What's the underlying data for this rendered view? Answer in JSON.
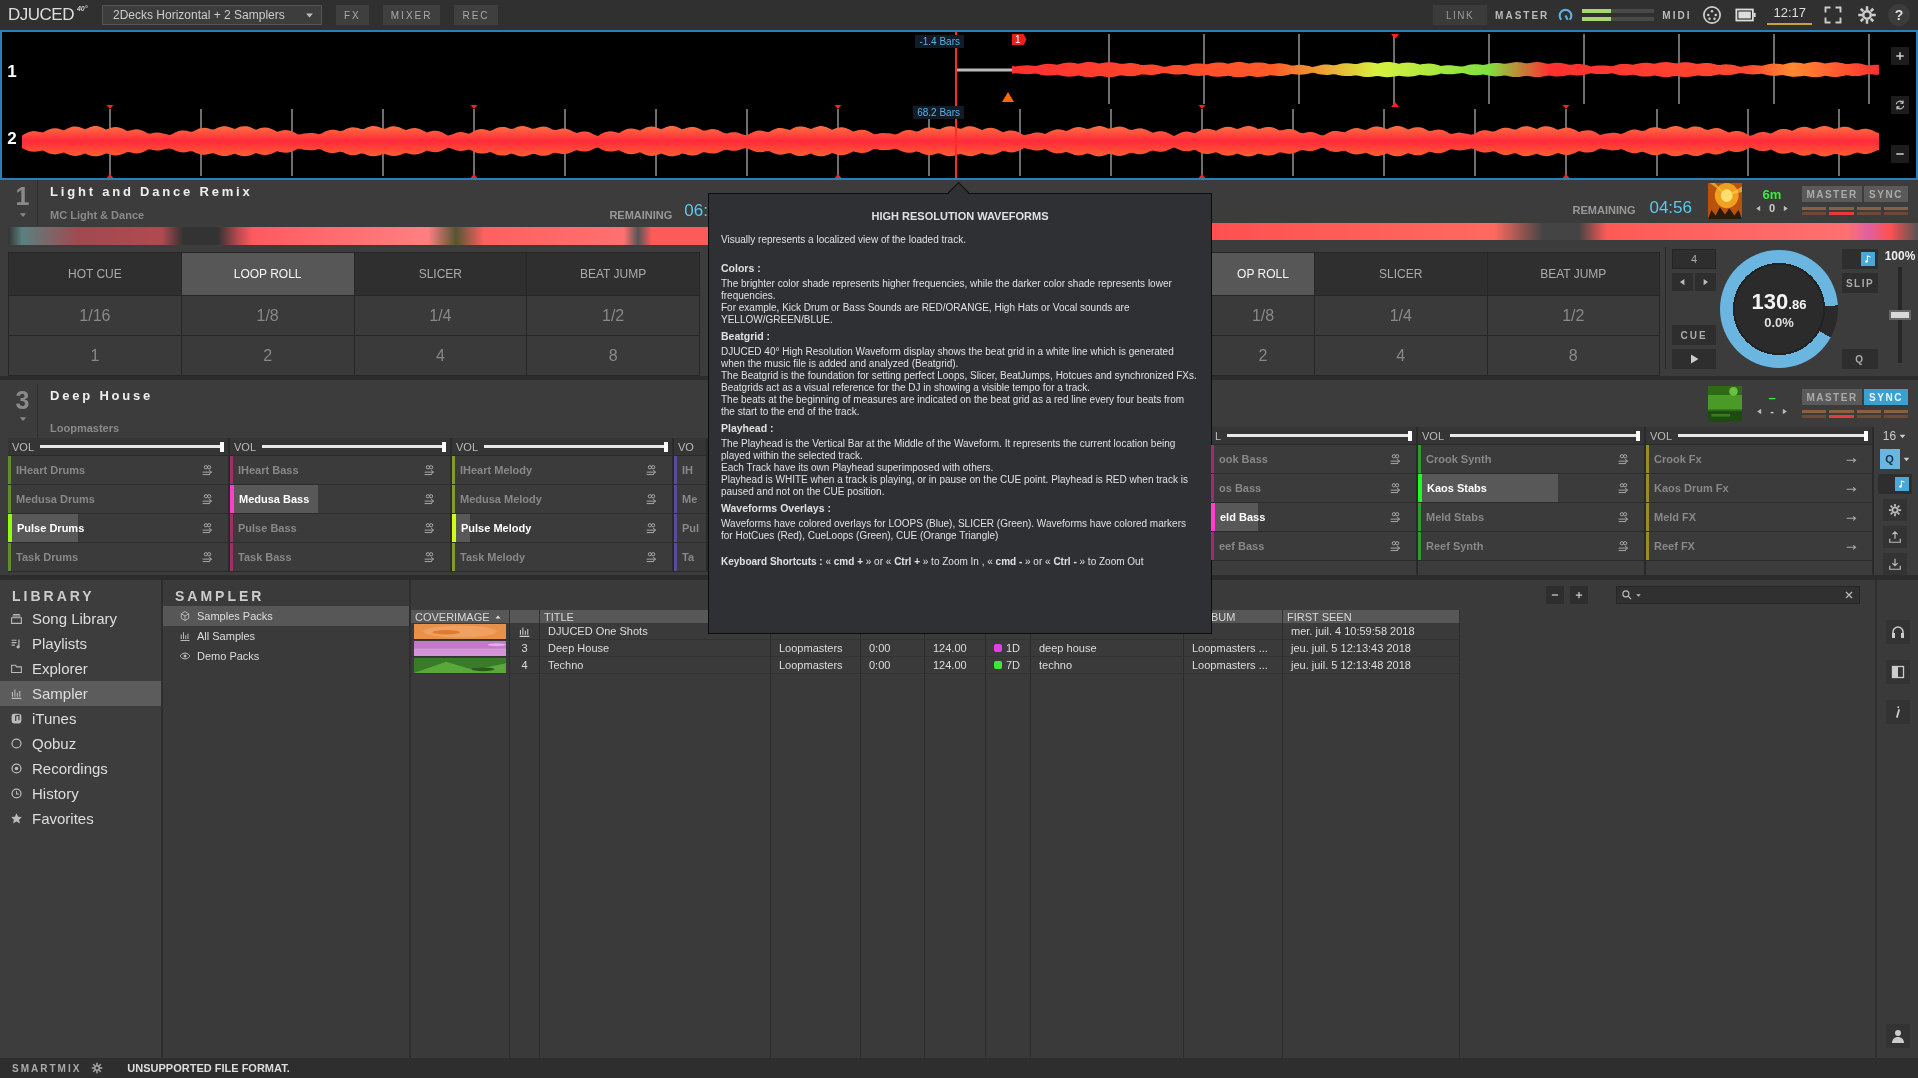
{
  "top_bar": {
    "logo": "DJUCED",
    "logo_mark": "40°",
    "layout": "2Decks Horizontal + 2 Samplers",
    "buttons": [
      {
        "label": "FX"
      },
      {
        "label": "MIXER"
      },
      {
        "label": "REC"
      }
    ],
    "link": "LINK",
    "master": "MASTER",
    "midi": "MIDI",
    "clock": "12:17",
    "help": "?"
  },
  "waveforms": {
    "lanes": [
      {
        "number": "1",
        "position": "-1.4 Bars",
        "cue_label": "1"
      },
      {
        "number": "2",
        "position": "68.2 Bars"
      }
    ]
  },
  "deck_1": {
    "number": "1",
    "title": "Light and Dance Remix",
    "artist": "MC Light & Dance",
    "remaining_label": "REMAINING",
    "remaining": "06:",
    "pad_modes": [
      {
        "label": "HOT CUE",
        "selected": false
      },
      {
        "label": "LOOP ROLL",
        "selected": true
      },
      {
        "label": "SLICER",
        "selected": false
      },
      {
        "label": "BEAT JUMP",
        "selected": false
      }
    ],
    "pads": [
      "1/16",
      "1/8",
      "1/4",
      "1/2",
      "1",
      "2",
      "4",
      "8"
    ]
  },
  "deck_2": {
    "remaining_label": "REMAINING",
    "remaining": "04:56",
    "key": "6m",
    "transpose": "0",
    "master": {
      "label": "MASTER",
      "on": false
    },
    "sync": {
      "label": "SYNC",
      "on": false
    },
    "pad_modes": [
      {
        "label": "OP ROLL",
        "selected": true
      },
      {
        "label": "SLICER",
        "selected": false
      },
      {
        "label": "BEAT JUMP",
        "selected": false
      }
    ],
    "pads": [
      "1/8",
      "1/4",
      "1/2",
      "2",
      "4",
      "8"
    ],
    "beats": "4",
    "cue": "CUE",
    "bpm": "130",
    "bpm_decimals": ".86",
    "pitch": "0.0%",
    "pitch_range": "100%",
    "slip": "SLIP",
    "quantize": "Q",
    "pitch_fader": {
      "level": 0.5
    }
  },
  "sampler_3": {
    "number": "3",
    "title": "Deep House",
    "artist": "Loopmasters",
    "columns": [
      {
        "vol": "VOL",
        "level": 1,
        "color": "#5f8f2a",
        "slots": [
          {
            "name": "IHeart Drums",
            "kind": "loop",
            "playing": false
          },
          {
            "name": "Medusa Drums",
            "kind": "loop",
            "playing": false
          },
          {
            "name": "Pulse Drums",
            "kind": "loop",
            "playing": true,
            "level": 0.32
          },
          {
            "name": "Task Drums",
            "kind": "loop",
            "playing": false
          }
        ]
      },
      {
        "vol": "VOL",
        "level": 1,
        "color": "#9b2f6a",
        "slots": [
          {
            "name": "IHeart Bass",
            "kind": "loop",
            "playing": false
          },
          {
            "name": "Medusa Bass",
            "kind": "loop",
            "playing": true,
            "level": 0.4
          },
          {
            "name": "Pulse Bass",
            "kind": "loop",
            "playing": false
          },
          {
            "name": "Task Bass",
            "kind": "loop",
            "playing": false
          }
        ]
      },
      {
        "vol": "VOL",
        "level": 1,
        "color": "#7f9a2f",
        "slots": [
          {
            "name": "IHeart Melody",
            "kind": "loop",
            "playing": false
          },
          {
            "name": "Medusa Melody",
            "kind": "loop",
            "playing": false
          },
          {
            "name": "Pulse Melody",
            "kind": "loop",
            "playing": true,
            "level": 0.08
          },
          {
            "name": "Task Melody",
            "kind": "loop",
            "playing": false
          }
        ]
      },
      {
        "vol": "VO",
        "color": "#5a4a9a",
        "slots": [
          {
            "name": "IH",
            "kind": "cut",
            "playing": false
          },
          {
            "name": "Me",
            "kind": "cut",
            "playing": false
          },
          {
            "name": "Pul",
            "kind": "cut",
            "playing": false
          },
          {
            "name": "Ta",
            "kind": "cut",
            "playing": false
          }
        ]
      }
    ]
  },
  "sampler_4": {
    "key": "–",
    "transpose": "-",
    "master": {
      "label": "MASTER",
      "on": false
    },
    "sync": {
      "label": "SYNC",
      "on": true
    },
    "columns": [
      {
        "vol": "L",
        "level": 1,
        "color": "#9b2f6a",
        "slots": [
          {
            "name": "ook Bass",
            "kind": "loop",
            "playing": false
          },
          {
            "name": "os Bass",
            "kind": "loop",
            "playing": false
          },
          {
            "name": "eld Bass",
            "kind": "loop",
            "playing": true,
            "level": 0.23
          },
          {
            "name": "eef Bass",
            "kind": "loop",
            "playing": false
          }
        ]
      },
      {
        "vol": "VOL",
        "level": 1,
        "color": "#2f9a2f",
        "slots": [
          {
            "name": "Crook Synth",
            "kind": "loop",
            "playing": false
          },
          {
            "name": "Kaos Stabs",
            "kind": "loop",
            "playing": true,
            "level": 0.62
          },
          {
            "name": "Meld Stabs",
            "kind": "loop",
            "playing": false
          },
          {
            "name": "Reef Synth",
            "kind": "loop",
            "playing": false
          }
        ]
      },
      {
        "vol": "VOL",
        "level": 1,
        "color": "#9a8a2a",
        "slots": [
          {
            "name": "Crook Fx",
            "kind": "oneshot",
            "playing": false
          },
          {
            "name": "Kaos Drum Fx",
            "kind": "oneshot",
            "playing": false
          },
          {
            "name": "Meld FX",
            "kind": "oneshot",
            "playing": false
          },
          {
            "name": "Reef FX",
            "kind": "oneshot",
            "playing": false
          }
        ]
      }
    ],
    "grid": "16",
    "quantize": "Q"
  },
  "tooltip": {
    "title": "HIGH RESOLUTION WAVEFORMS",
    "intro": "Visually represents a localized view of the loaded track.",
    "sections": [
      {
        "heading": "Colors :",
        "lines": [
          "The brighter color shade represents higher frequencies, while the darker color shade represents lower frequencies.",
          "For example, Kick Drum or Bass Sounds are RED/ORANGE, High Hats or Vocal sounds are YELLOW/GREEN/BLUE."
        ]
      },
      {
        "heading": "Beatgrid :",
        "lines": [
          "DJUCED 40° High Resolution Waveform display shows the beat grid in a white line which is generated when the music file is added and analyzed (Beatgrid).",
          "The Beatgrid is the foundation for setting perfect Loops, Slicer, BeatJumps, Hotcues and synchronized FXs.",
          "Beatgrids act as a visual reference for the DJ in showing a visible tempo for a track.",
          "The beats at the beginning of measures are indicated on the beat grid as a red line every four beats from the start to the end of the track."
        ]
      },
      {
        "heading": "Playhead :",
        "lines": [
          "The Playhead is the Vertical Bar at the Middle of the Waveform. It represents the current location being played within the selected track.",
          "Each Track have its own Playhead superimposed with others.",
          "Playhead is WHITE when a track is playing, or in pause on the CUE point. Playhead is RED when track is paused and not on the CUE position."
        ]
      },
      {
        "heading": "Waveforms Overlays :",
        "lines": [
          "Waveforms have colored overlays for LOOPS (Blue), SLICER (Green). Waveforms have colored markers for HotCues (Red), CueLoops (Green), CUE (Orange Triangle)"
        ]
      }
    ],
    "shortcuts": "**Keyboard Shortcuts :**   « **cmd +** » or « **Ctrl +** » to Zoom In ,    « **cmd -** » or « **Ctrl -** » to Zoom Out"
  },
  "library": {
    "heading": "LIBRARY",
    "items": [
      {
        "label": "Song Library",
        "selected": false
      },
      {
        "label": "Playlists",
        "selected": false
      },
      {
        "label": "Explorer",
        "selected": false
      },
      {
        "label": "Sampler",
        "selected": true
      },
      {
        "label": "iTunes",
        "selected": false
      },
      {
        "label": "Qobuz",
        "selected": false
      },
      {
        "label": "Recordings",
        "selected": false
      },
      {
        "label": "History",
        "selected": false
      },
      {
        "label": "Favorites",
        "selected": false
      }
    ]
  },
  "sampler_tree": {
    "heading": "SAMPLER",
    "items": [
      {
        "label": "Samples Packs",
        "selected": true
      },
      {
        "label": "All Samples",
        "selected": false
      },
      {
        "label": "Demo Packs",
        "selected": false
      }
    ]
  },
  "table": {
    "columns": [
      {
        "label": "COVERIMAGE",
        "sorted": true
      },
      {
        "label": "TITLE",
        "sorted": false
      },
      {
        "label": "BUM",
        "sorted": false
      },
      {
        "label": "FIRST SEEN",
        "sorted": false
      }
    ],
    "rows": [
      {
        "kind": "pack",
        "title": "DJUCED One Shots",
        "first_seen": "mer. juil. 4 10:59:58 2018"
      },
      {
        "kind": "sample",
        "number": "3",
        "title": "Deep House",
        "column_4": "Loopmasters",
        "column_5": "0:00",
        "column_6": "124.00",
        "color": "#e83ce8",
        "column_7": "1D",
        "column_8": "deep house",
        "column_9": "Loopmasters ...",
        "first_seen": "jeu. juil. 5 12:13:43 2018"
      },
      {
        "kind": "sample",
        "number": "4",
        "title": "Techno",
        "column_4": "Loopmasters",
        "column_5": "0:00",
        "column_6": "124.00",
        "color": "#3ce83c",
        "column_7": "7D",
        "column_8": "techno",
        "column_9": "Loopmasters ...",
        "first_seen": "jeu. juil. 5 12:13:48 2018"
      }
    ]
  },
  "status_bar": {
    "smartmix": "SMARTMIX",
    "message": "UNSUPPORTED FILE FORMAT."
  }
}
